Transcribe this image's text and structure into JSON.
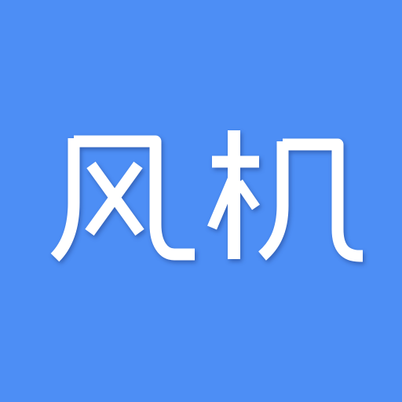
{
  "icon": {
    "brand_text": "风机",
    "background_color": "#4d8ef5",
    "glyph_color": "#ffffff"
  }
}
